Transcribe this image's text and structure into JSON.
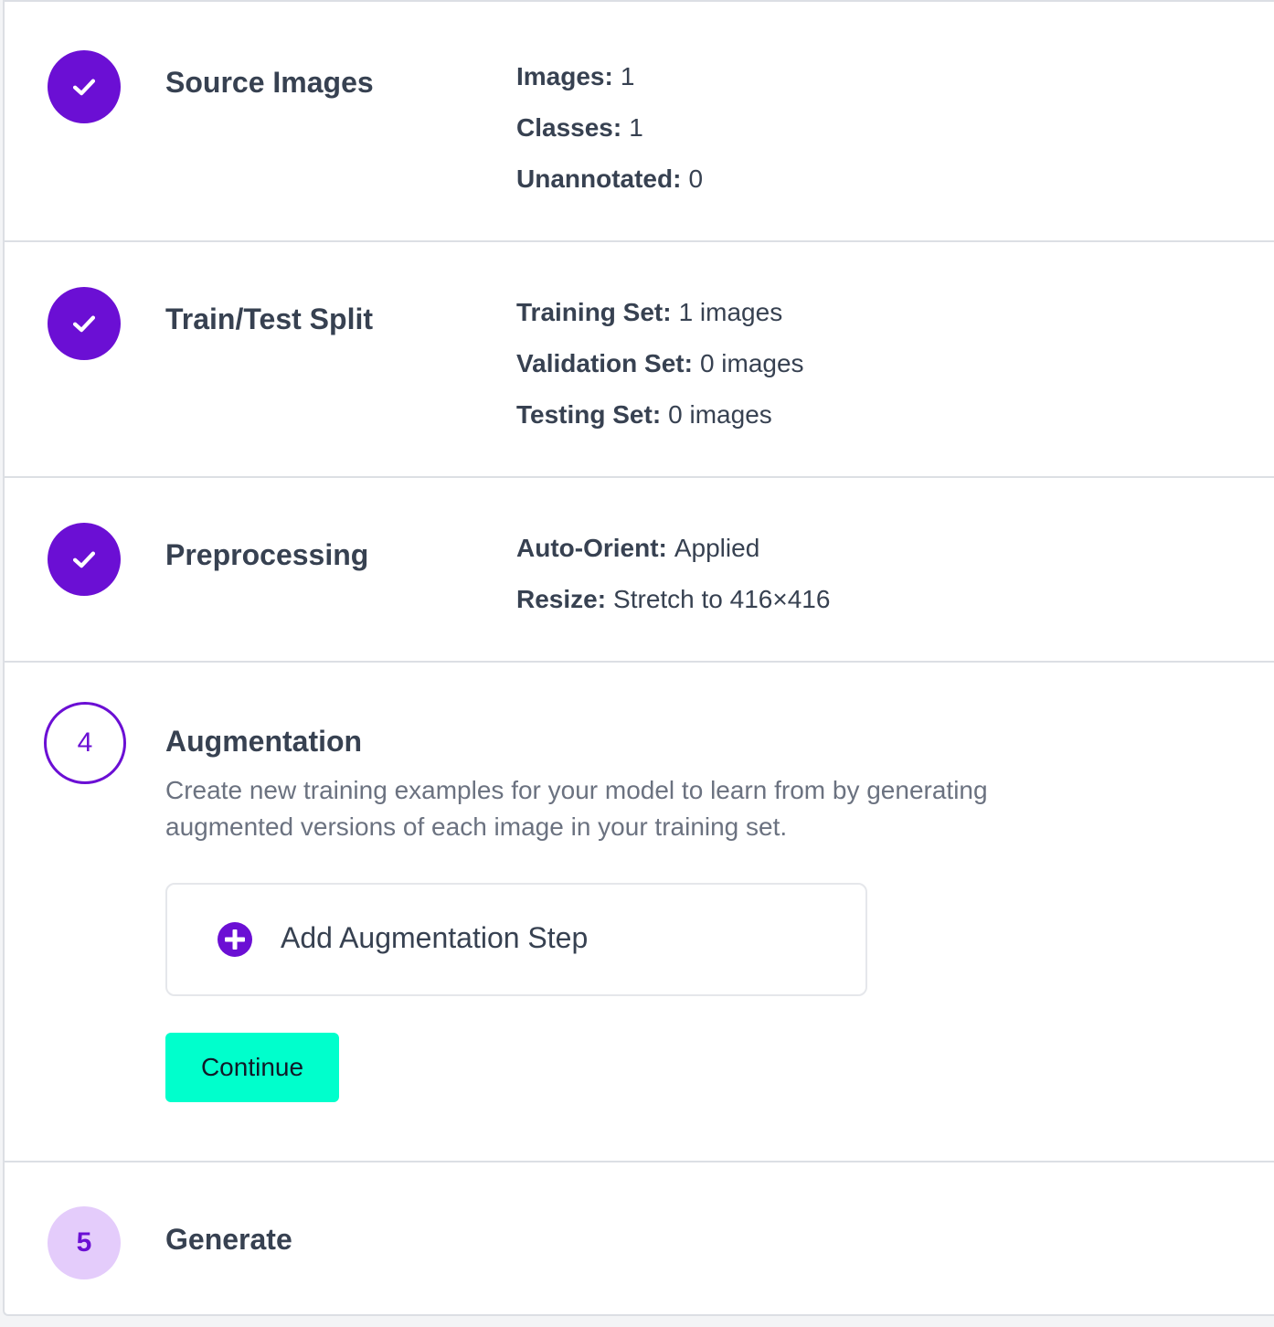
{
  "colors": {
    "accent": "#6b0fd4",
    "accent_light": "#e4ccfb",
    "continue_bg": "#00ffcc",
    "border": "#dcdfe4"
  },
  "steps": [
    {
      "status": "completed",
      "badge_icon": "check-icon",
      "title": "Source Images",
      "details": [
        {
          "label": "Images:",
          "value": "1"
        },
        {
          "label": "Classes:",
          "value": "1"
        },
        {
          "label": "Unannotated:",
          "value": "0"
        }
      ]
    },
    {
      "status": "completed",
      "badge_icon": "check-icon",
      "title": "Train/Test Split",
      "details": [
        {
          "label": "Training Set:",
          "value": "1 images"
        },
        {
          "label": "Validation Set:",
          "value": "0 images"
        },
        {
          "label": "Testing Set:",
          "value": "0 images"
        }
      ]
    },
    {
      "status": "completed",
      "badge_icon": "check-icon",
      "title": "Preprocessing",
      "details": [
        {
          "label": "Auto-Orient:",
          "value": "Applied"
        },
        {
          "label": "Resize:",
          "value": "Stretch to 416×416"
        }
      ]
    },
    {
      "status": "current",
      "number": "4",
      "title": "Augmentation",
      "description": "Create new training examples for your model to learn from by generating augmented versions of each image in your training set.",
      "add_step_label": "Add Augmentation Step",
      "add_step_icon": "plus-circle-icon",
      "continue_label": "Continue"
    },
    {
      "status": "upcoming",
      "number": "5",
      "title": "Generate"
    }
  ]
}
